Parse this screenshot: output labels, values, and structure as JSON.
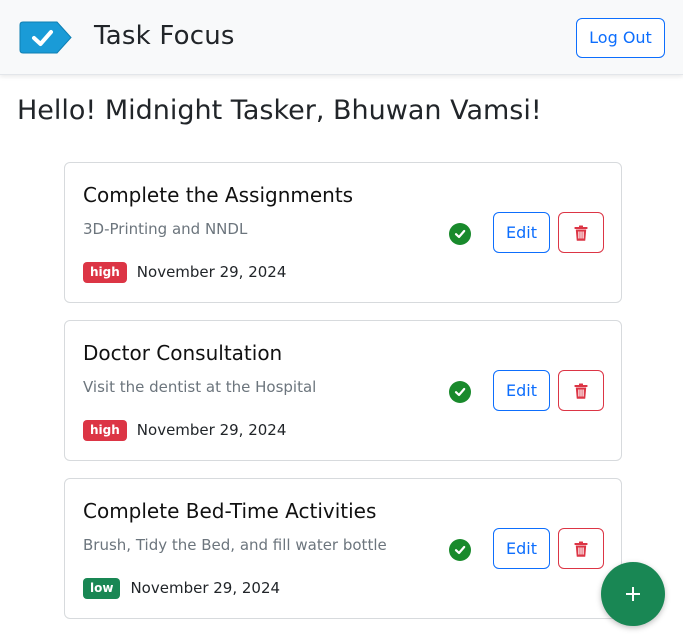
{
  "app": {
    "brand": "Task Focus",
    "logout_label": "Log Out"
  },
  "greeting": "Hello! Midnight Tasker, Bhuwan Vamsi!",
  "tasks": [
    {
      "title": "Complete the Assignments",
      "description": "3D-Printing and NNDL",
      "priority": "high",
      "date": "November 29, 2024",
      "edit_label": "Edit"
    },
    {
      "title": "Doctor Consultation",
      "description": "Visit the dentist at the Hospital",
      "priority": "high",
      "date": "November 29, 2024",
      "edit_label": "Edit"
    },
    {
      "title": "Complete Bed-Time Activities",
      "description": "Brush, Tidy the Bed, and fill water bottle",
      "priority": "low",
      "date": "November 29, 2024",
      "edit_label": "Edit"
    }
  ],
  "fab_label": "+",
  "colors": {
    "primary": "#0d6efd",
    "danger": "#dc3545",
    "success": "#198754",
    "check": "#198a2c",
    "logo": "#1a9bd7",
    "priority_high": "#dc3545",
    "priority_low": "#198754"
  },
  "icons": {
    "logo": "check-tag-icon",
    "complete": "check-circle-icon",
    "delete": "trash-icon",
    "add": "plus-icon"
  }
}
